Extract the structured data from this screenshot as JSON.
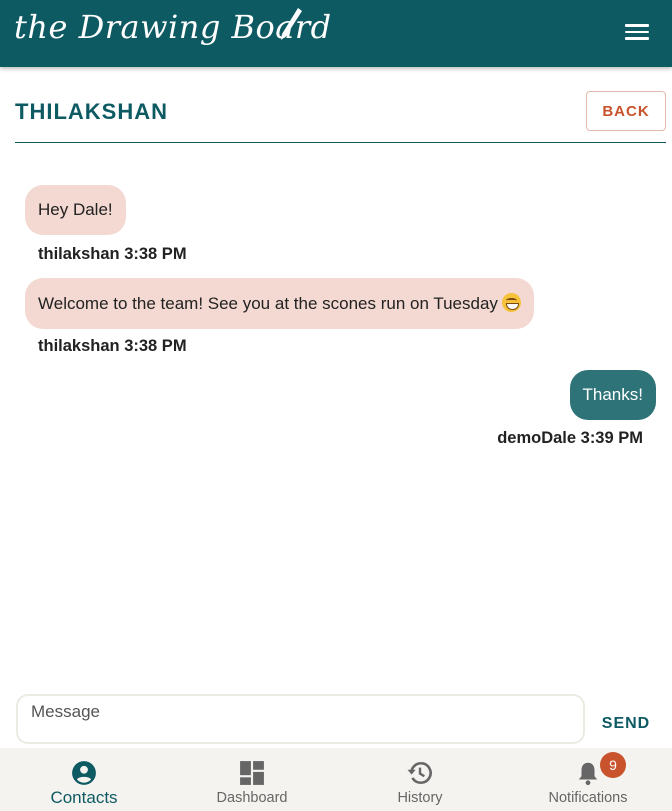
{
  "app": {
    "logo_text": "the Drawing Board",
    "menu_icon": "hamburger-menu-icon",
    "brand_color": "#0e5a63",
    "accent_color": "#c8532c"
  },
  "chat": {
    "contact_name": "THILAKSHAN",
    "back_label": "BACK",
    "messages": [
      {
        "direction": "incoming",
        "text": "Hey Dale!",
        "sender": "thilakshan",
        "time": "3:38 PM"
      },
      {
        "direction": "incoming",
        "text": "Welcome to the team! See you at the scones run on Tuesday",
        "emoji": "grinning-face-emoji",
        "sender": "thilakshan",
        "time": "3:38 PM"
      },
      {
        "direction": "outgoing",
        "text": "Thanks!",
        "sender": "demoDale",
        "time": "3:39 PM"
      }
    ],
    "input": {
      "placeholder": "Message",
      "value": ""
    },
    "send_label": "SEND"
  },
  "bottom_nav": {
    "items": [
      {
        "label": "Contacts",
        "icon": "account-circle-icon",
        "active": true
      },
      {
        "label": "Dashboard",
        "icon": "dashboard-icon",
        "active": false
      },
      {
        "label": "History",
        "icon": "history-icon",
        "active": false
      },
      {
        "label": "Notifications",
        "icon": "bell-icon",
        "active": false
      }
    ],
    "notifications_badge": "9"
  }
}
